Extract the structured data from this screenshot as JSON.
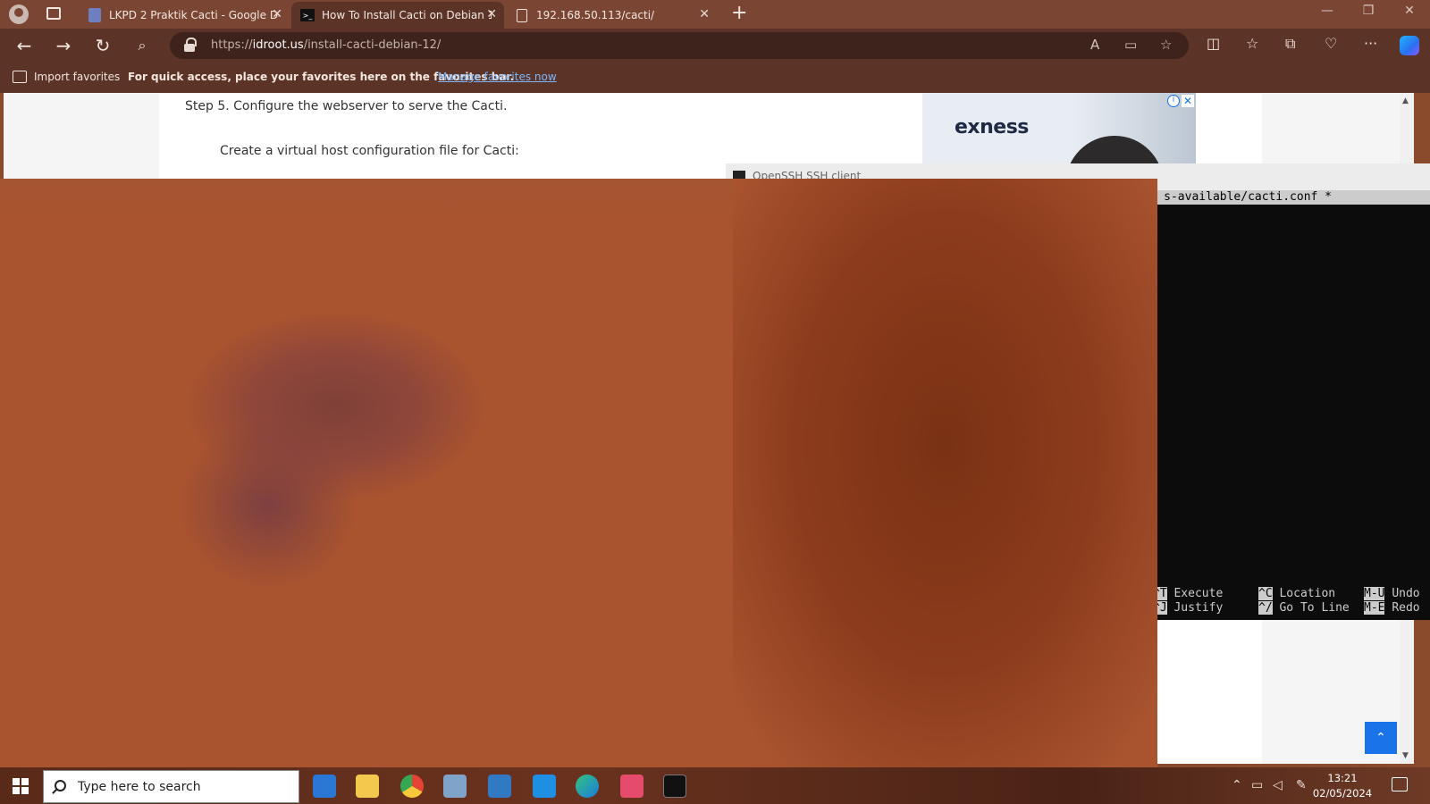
{
  "browser": {
    "tabs": [
      {
        "title": "LKPD 2 Praktik Cacti - Google Dc",
        "icon": "google-docs-icon"
      },
      {
        "title": "How To Install Cacti on Debian 1.",
        "icon": "terminal-icon",
        "active": true
      },
      {
        "title": "192.168.50.113/cacti/",
        "icon": "page-icon"
      }
    ],
    "url_domain": "idroot.us",
    "url_prefix": "https://",
    "url_path": "/install-cacti-debian-12/",
    "favorites": {
      "import_label": "Import favorites",
      "message": "For quick access, place your favorites here on the favorites bar.",
      "link": "Manage favorites now"
    }
  },
  "article": {
    "step": "Step 5. Configure the webserver to serve the Cacti.",
    "instruction": "Create a virtual host configuration file for Cacti:"
  },
  "ad": {
    "brand": "exness"
  },
  "terminal": {
    "title": "OpenSSH SSH client",
    "file_header": "s-available/cacti.conf *",
    "shortcuts": [
      {
        "key": "^T",
        "label": "Execute"
      },
      {
        "key": "^J",
        "label": "Justify"
      },
      {
        "key": "^C",
        "label": "Location"
      },
      {
        "key": "^/",
        "label": "Go To Line"
      },
      {
        "key": "M-U",
        "label": "Undo"
      },
      {
        "key": "M-E",
        "label": "Redo"
      }
    ]
  },
  "taskbar": {
    "search_placeholder": "Type here to search",
    "apps": [
      "mail-icon",
      "file-explorer-icon",
      "chrome-icon",
      "virtualbox-icon",
      "wireshark-icon",
      "vscode-icon",
      "edge-icon",
      "app-icon",
      "terminal-icon"
    ],
    "time": "13:21",
    "date": "02/05/2024"
  }
}
